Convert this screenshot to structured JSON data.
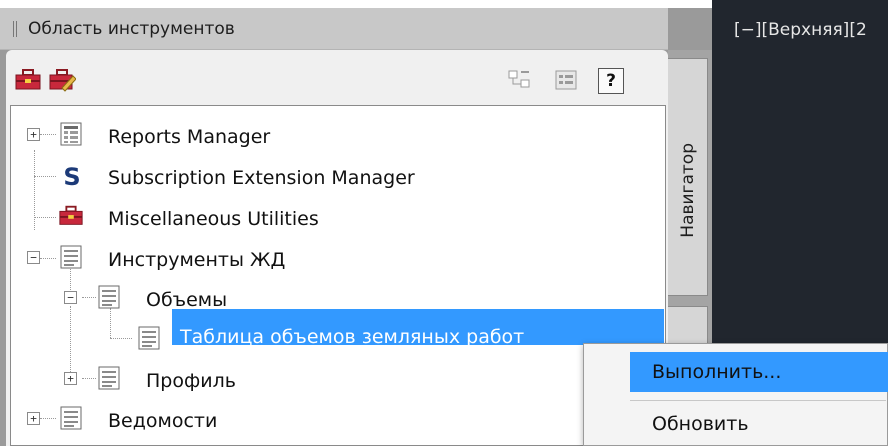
{
  "palette": {
    "title": "Область инструментов",
    "side_tab_label": "Навигатор"
  },
  "viewport": {
    "label": "[−][Верхняя][2"
  },
  "toolbar": {
    "help_label": "?"
  },
  "tree": {
    "items": [
      {
        "label": "Reports Manager",
        "icon": "reports-icon",
        "expander": "+"
      },
      {
        "label": "Subscription Extension Manager",
        "icon": "subscription-s-icon"
      },
      {
        "label": "Miscellaneous Utilities",
        "icon": "toolbox-icon"
      },
      {
        "label": "Инструменты ЖД",
        "icon": "document-icon",
        "expander": "−"
      },
      {
        "label": "Объемы",
        "icon": "document-icon",
        "expander": "−"
      },
      {
        "label": "Таблица объемов земляных работ",
        "icon": "document-icon",
        "selected": true
      },
      {
        "label": "Профиль",
        "icon": "document-icon",
        "expander": "+"
      },
      {
        "label": "Ведомости",
        "icon": "document-icon",
        "expander": "+"
      }
    ]
  },
  "context_menu": {
    "items": [
      {
        "label": "Выполнить...",
        "highlighted": true
      },
      {
        "label": "Обновить"
      }
    ]
  },
  "colors": {
    "selection": "#3399ff",
    "toolbox_red": "#c8283c",
    "viewport_bg": "#21262e"
  }
}
